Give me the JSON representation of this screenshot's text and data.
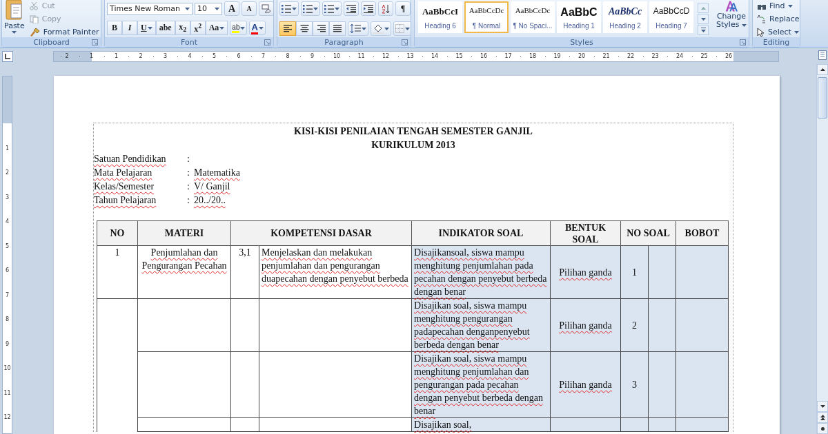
{
  "ribbon": {
    "clipboard": {
      "label": "Clipboard",
      "paste": "Paste",
      "items": [
        "Cut",
        "Copy",
        "Format Painter"
      ]
    },
    "font": {
      "label": "Font",
      "name": "Times New Roman",
      "size": "10",
      "grow": "A",
      "shrink": "A",
      "format_buttons": [
        "B",
        "I",
        "U",
        "abe",
        "x$_{2}$",
        "x$^{2}$",
        "Aa"
      ],
      "highlight": "ab",
      "font_color_label": "A"
    },
    "paragraph": {
      "label": "Paragraph",
      "pilcrow": "¶",
      "alignments": [
        {
          "kind": "left",
          "selected": true
        },
        {
          "kind": "center",
          "selected": false
        },
        {
          "kind": "right",
          "selected": false
        },
        {
          "kind": "justify",
          "selected": false
        }
      ]
    },
    "styles": {
      "label": "Styles",
      "gallery": [
        {
          "kind": "bold",
          "preview": "AaBbCcI",
          "name": "Heading 6",
          "selected": false
        },
        {
          "kind": "plain",
          "preview": "AaBbCcDc",
          "name": "¶ Normal",
          "selected": true
        },
        {
          "kind": "plain",
          "preview": "AaBbCcDc",
          "name": "¶ No Spaci...",
          "selected": false
        },
        {
          "kind": "large",
          "preview": "AaBbC",
          "name": "Heading 1",
          "selected": false
        },
        {
          "kind": "italic",
          "preview": "AaBbCc",
          "name": "Heading 2",
          "selected": false
        },
        {
          "kind": "sans",
          "preview": "AaBbCcD",
          "name": "Heading 7",
          "selected": false
        }
      ],
      "change": [
        "Change",
        "Styles"
      ]
    },
    "editing": {
      "label": "Editing",
      "items": [
        "Find",
        "Replace",
        "Select"
      ]
    }
  },
  "ruler": {
    "left_numbers": [
      "2",
      "1"
    ],
    "numbers": [
      "1",
      "2",
      "3",
      "4",
      "5",
      "6",
      "7",
      "8",
      "9",
      "10",
      "11",
      "12",
      "13",
      "14",
      "15",
      "16",
      "17",
      "18",
      "19",
      "20",
      "21",
      "22",
      "23",
      "24",
      "25",
      "26"
    ]
  },
  "vertical_ruler": {
    "numbers": [
      "1",
      "2",
      "3",
      "4",
      "5",
      "6",
      "7",
      "8",
      "9",
      "10",
      "11",
      "12"
    ]
  },
  "document": {
    "title": [
      "KISI-KISI PENILAIAN TENGAH SEMESTER GANJIL",
      "KURIKULUM 2013"
    ],
    "info": [
      {
        "label": "Satuan Pendidikan",
        "colon": ":"
      },
      {
        "label": "Mata Pelajaran",
        "colon": ":",
        "value": "Matematika"
      },
      {
        "label": "Kelas/Semester",
        "colon": ":",
        "value": "V/ Ganjil"
      },
      {
        "label": "Tahun Pelajaran",
        "colon": ":",
        "value": "20../20.."
      }
    ],
    "table": {
      "headers": [
        "NO",
        "MATERI",
        "KOMPETENSI DASAR",
        "INDIKATOR SOAL",
        "BENTUK SOAL",
        "NO SOAL",
        "BOBOT"
      ],
      "rows": [
        {
          "no": "1",
          "materi": "Penjumlahan dan Pengurangan Pecahan",
          "kd_no": "3,1",
          "kd": "Menjelaskan dan melakukan penjumlahan dan pengurangan duapecahan dengan penyebut berbeda",
          "indikator": "Disajikansoal, siswa mampu menghitung penjumlahan pada pecahan dengan penyebut berbeda dengan benar",
          "bentuk": "Pilihan ganda",
          "no_soal": "1"
        },
        {
          "indikator": "Disajikan soal, siswa mampu menghitung pengurangan padapecahan denganpenyebut berbeda dengan benar",
          "bentuk": "Pilihan ganda",
          "no_soal": "2"
        },
        {
          "indikator": "Disajikan soal, siswa mampu menghitung penjumlahan dan pengurangan pada pecahan dengan penyebut berbeda dengan benar",
          "bentuk": "Pilihan ganda",
          "no_soal": "3"
        },
        {
          "indikator": "Disajikan soal,"
        }
      ]
    }
  }
}
